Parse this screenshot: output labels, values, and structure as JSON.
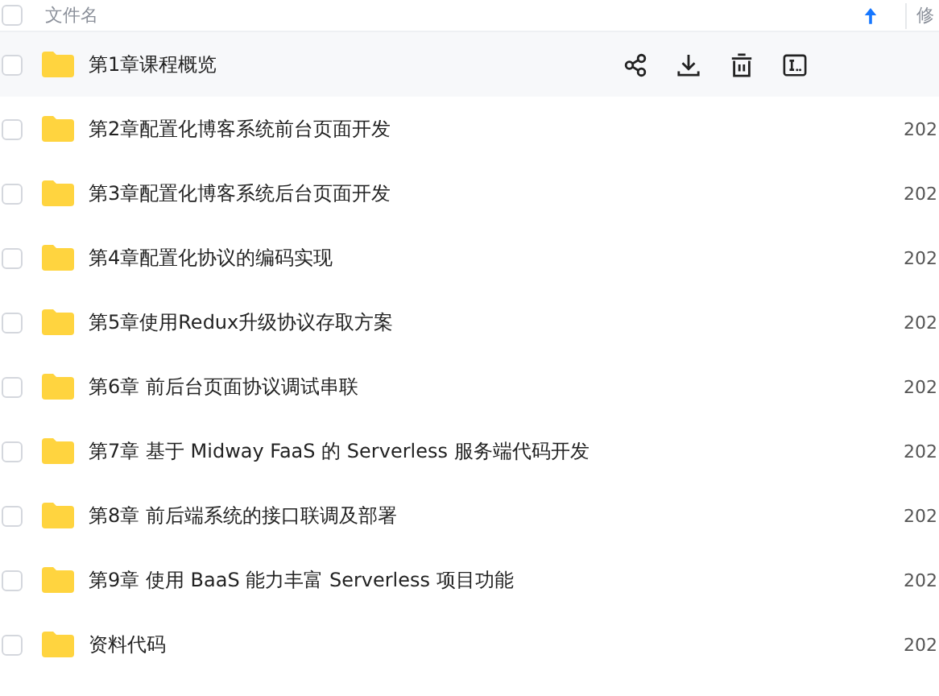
{
  "header": {
    "checked": false,
    "name_column": "文件名",
    "sort_ascending": true,
    "column_2": "修"
  },
  "rows": [
    {
      "name": "第1章课程概览",
      "date": "",
      "hovered": true,
      "checked": false
    },
    {
      "name": "第2章配置化博客系统前台页面开发",
      "date": "202",
      "hovered": false,
      "checked": false
    },
    {
      "name": "第3章配置化博客系统后台页面开发",
      "date": "202",
      "hovered": false,
      "checked": false
    },
    {
      "name": "第4章配置化协议的编码实现",
      "date": "202",
      "hovered": false,
      "checked": false
    },
    {
      "name": "第5章使用Redux升级协议存取方案",
      "date": "202",
      "hovered": false,
      "checked": false
    },
    {
      "name": "第6章 前后台页面协议调试串联",
      "date": "202",
      "hovered": false,
      "checked": false
    },
    {
      "name": "第7章 基于 Midway FaaS 的 Serverless 服务端代码开发",
      "date": "202",
      "hovered": false,
      "checked": false
    },
    {
      "name": "第8章 前后端系统的接口联调及部署",
      "date": "202",
      "hovered": false,
      "checked": false
    },
    {
      "name": "第9章 使用 BaaS 能力丰富 Serverless 项目功能",
      "date": "202",
      "hovered": false,
      "checked": false
    },
    {
      "name": "资料代码",
      "date": "202",
      "hovered": false,
      "checked": false
    }
  ]
}
